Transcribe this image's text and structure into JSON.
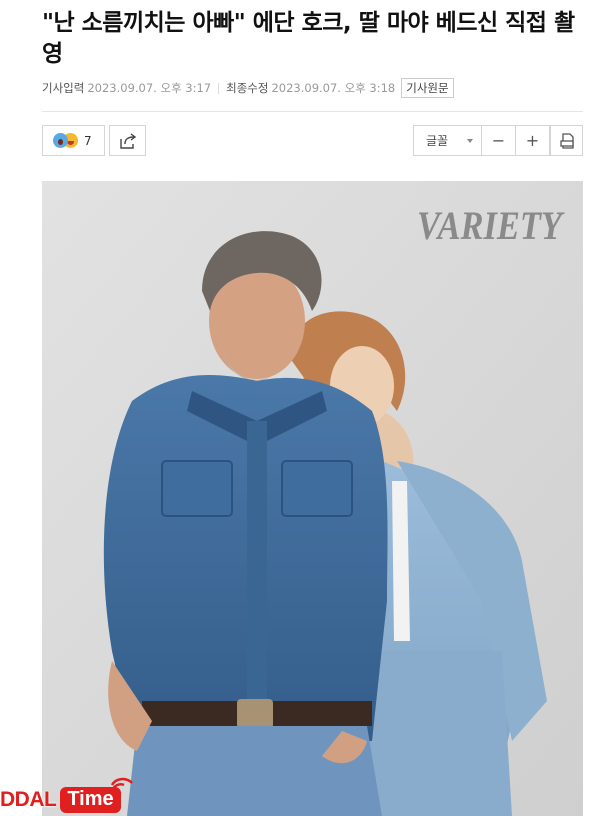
{
  "article": {
    "headline": "\"난 소름끼치는 아빠\" 에단 호크, 딸 마야 베드신 직접 촬영"
  },
  "meta": {
    "published_label": "기사입력",
    "published_value": "2023.09.07. 오후 3:17",
    "modified_label": "최종수정",
    "modified_value": "2023.09.07. 오후 3:18",
    "source_button": "기사원문"
  },
  "toolbar": {
    "reaction_count": "7",
    "font_label": "글꼴",
    "decrease_label": "−",
    "increase_label": "+"
  },
  "photo": {
    "brand_logo": "VARIETY"
  },
  "watermark": {
    "left": "DDAL",
    "right": "Time"
  },
  "icons": [
    "shocked-emoji-icon",
    "laugh-emoji-icon",
    "share-icon",
    "chevron-down-icon",
    "print-icon",
    "signal-wave-icon"
  ],
  "colors": {
    "watermark_red": "#e01f1f",
    "denim_dark": "#3d6a9a",
    "denim_light": "#8fb1d0",
    "backdrop": "#dcdcdc"
  }
}
